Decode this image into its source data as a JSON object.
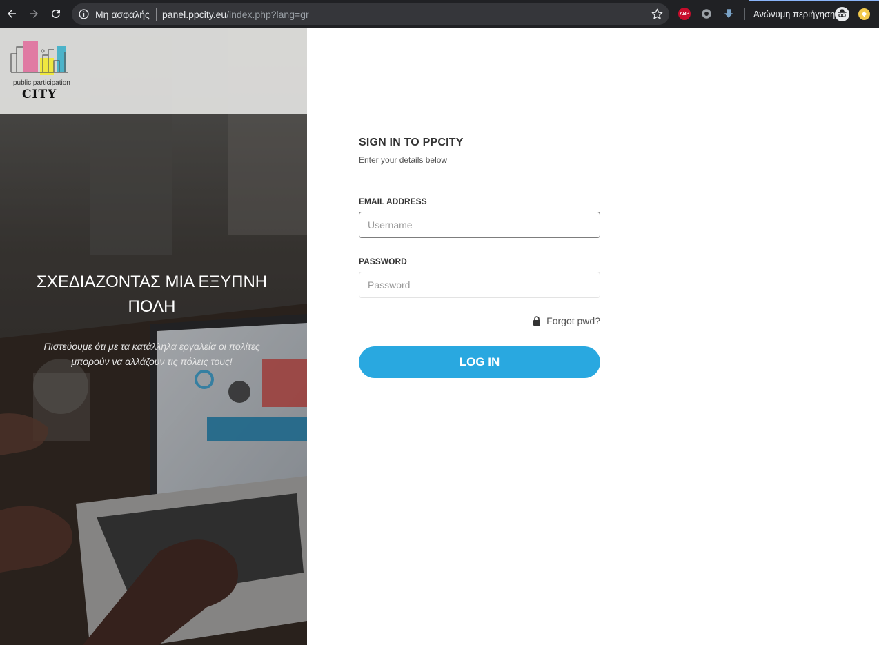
{
  "browser": {
    "security_label": "Μη ασφαλής",
    "url_host": "panel.ppcity.eu",
    "url_path": "/index.php?lang=gr",
    "incognito_label": "Ανώνυμη περιήγηση",
    "abp_label": "ABP",
    "icons": [
      "back-arrow-icon",
      "forward-arrow-icon",
      "reload-icon",
      "info-icon",
      "star-icon",
      "adblock-icon",
      "extension-icon",
      "download-icon",
      "incognito-icon"
    ]
  },
  "brand": {
    "logo_line1": "public participation",
    "logo_line2": "CITY"
  },
  "hero": {
    "title": "ΣΧΕΔΙΑΖΟΝΤΑΣ ΜΙΑ ΕΞΥΠΝΗ ΠΟΛΗ",
    "text": "Πιστεύουμε ότι με τα κατάλληλα εργαλεία οι πολίτες μπορούν να αλλάζουν τις πόλεις τους!"
  },
  "form": {
    "title": "SIGN IN TO PPCITY",
    "subtitle": "Enter your details below",
    "email_label": "EMAIL ADDRESS",
    "email_placeholder": "Username",
    "email_value": "",
    "password_label": "PASSWORD",
    "password_placeholder": "Password",
    "password_value": "",
    "forgot_label": "Forgot pwd?",
    "login_label": "LOG IN"
  },
  "colors": {
    "accent": "#29a8e0",
    "chrome_bg": "#202124"
  }
}
